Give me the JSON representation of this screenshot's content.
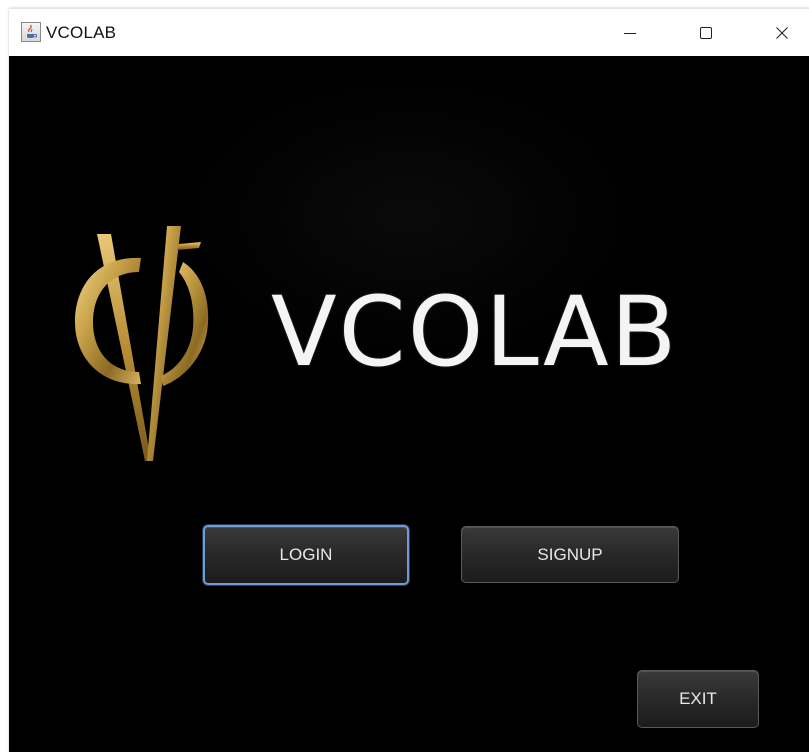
{
  "window": {
    "title": "VCOLAB",
    "app_icon": "java-app-icon",
    "controls": {
      "minimize_icon": "minimize-icon",
      "maximize_icon": "maximize-icon",
      "close_icon": "close-icon"
    }
  },
  "logo": {
    "mark_icon": "vc-monogram-logo",
    "wordmark": "VCOLAB",
    "mark_color": "#c9a24a"
  },
  "buttons": {
    "login": "LOGIN",
    "signup": "SIGNUP",
    "exit": "EXIT"
  },
  "colors": {
    "background": "#000000",
    "button_focus_border": "#6d9fd6",
    "wordmark": "#f4f4f4"
  }
}
